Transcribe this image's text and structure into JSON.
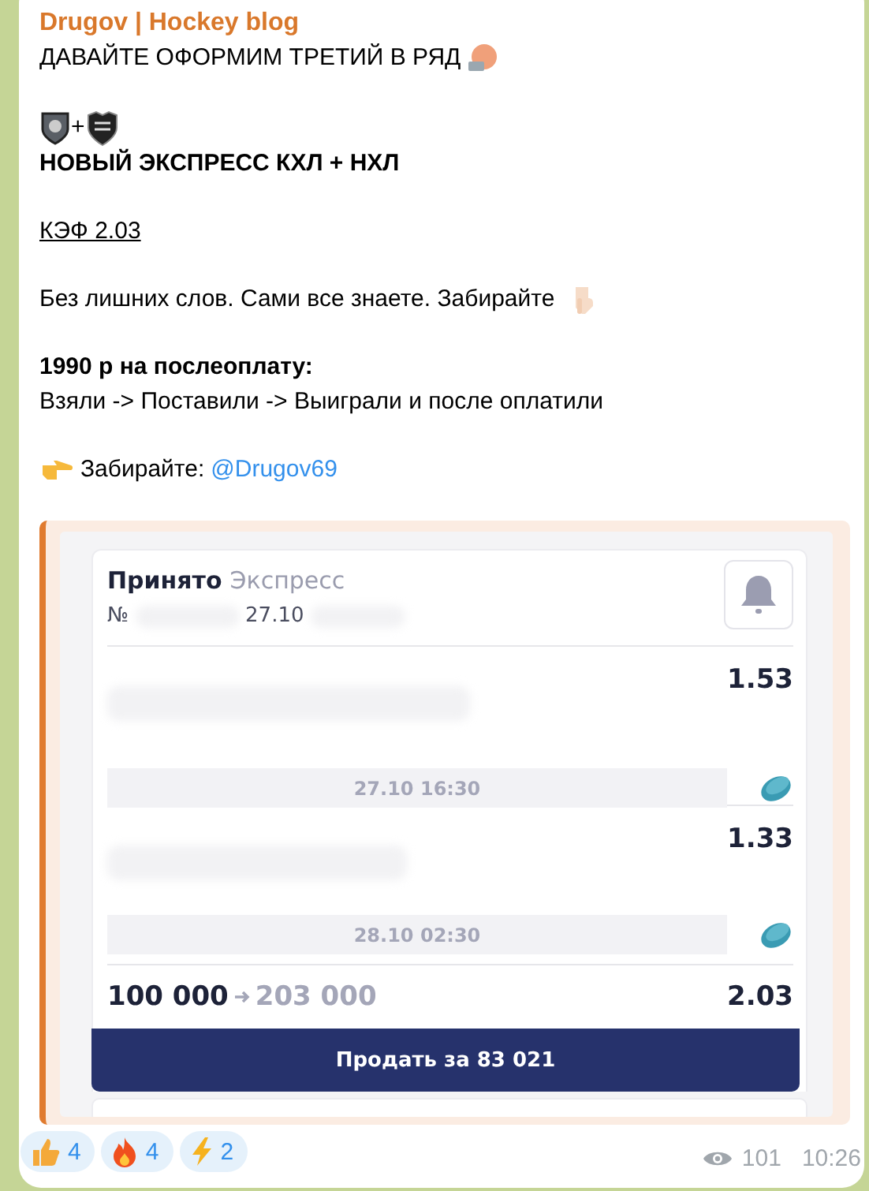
{
  "channel": {
    "name": "Drugov | Hockey blog"
  },
  "paragraphs": [
    {
      "lines": [
        {
          "kind": "headline",
          "text": "ДАВАЙТЕ ОФОРМИМ ТРЕТИЙ В РЯД"
        }
      ]
    },
    {
      "lines": [
        {
          "kind": "logos",
          "text": "+"
        },
        {
          "kind": "bold",
          "text": "НОВЫЙ ЭКСПРЕСС КХЛ + НХЛ"
        }
      ]
    },
    {
      "lines": [
        {
          "kind": "underline",
          "text": "КЭФ 2.03"
        }
      ]
    },
    {
      "lines": [
        {
          "kind": "pointing-down",
          "text": "Без лишних слов. Сами все знаете. Забирайте"
        }
      ]
    },
    {
      "lines": [
        {
          "kind": "bold",
          "text": "1990 р на послеоплату:"
        },
        {
          "kind": "text",
          "text": "Взяли -> Поставили -> Выиграли и после оплатили"
        }
      ]
    },
    {
      "lines": [
        {
          "kind": "cta",
          "text": "Забирайте:",
          "link": "@Drugov69"
        }
      ]
    }
  ],
  "bet_slip": {
    "status": "Принято",
    "type": "Экспресс",
    "number_prefix": "№",
    "date": "27.10",
    "legs": [
      {
        "odds": "1.53",
        "time": "27.10 16:30"
      },
      {
        "odds": "1.33",
        "time": "28.10 02:30"
      }
    ],
    "stake": "100 000",
    "payout": "203 000",
    "total_odds": "2.03",
    "sell_button": "Продать за 83 021"
  },
  "reactions": [
    {
      "kind": "thumbs-up",
      "count": "4"
    },
    {
      "kind": "fire",
      "count": "4"
    },
    {
      "kind": "lightning",
      "count": "2"
    }
  ],
  "views": "101",
  "time": "10:26"
}
